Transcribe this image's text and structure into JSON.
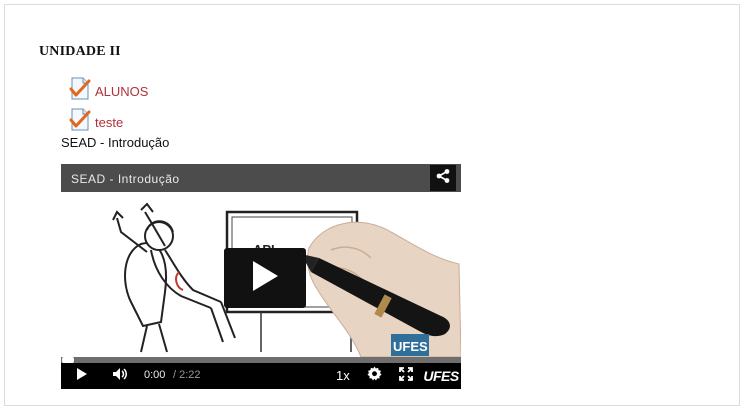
{
  "section": {
    "title": "UNIDADE II"
  },
  "links": [
    {
      "label": "ALUNOS",
      "icon": "checked-document-icon"
    },
    {
      "label": "teste",
      "icon": "checked-document-icon"
    }
  ],
  "video": {
    "caption": "SEAD - Introdução",
    "title": "SEAD - Introdução",
    "current_time": "0:00",
    "duration": "/ 2:22",
    "speed": "1x",
    "progress": 0,
    "logo": "UFES",
    "board_text": "API"
  },
  "colors": {
    "link": "#b0323a",
    "titlebar": "#4c4c4c",
    "controls": "#000000"
  }
}
